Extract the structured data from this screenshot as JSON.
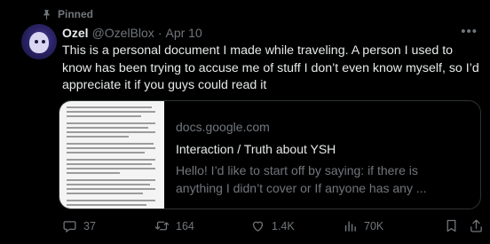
{
  "pinned": {
    "label": "Pinned"
  },
  "author": {
    "display_name": "Ozel",
    "handle": "@OzelBlox",
    "separator": "·",
    "date": "Apr 10"
  },
  "tweet": {
    "text": "This is a personal document I made while traveling. A person I used to know has been trying to accuse me of stuff I don’t even know myself, so I’d appreciate it if you guys could read it"
  },
  "card": {
    "domain": "docs.google.com",
    "title": "Interaction / Truth about YSH",
    "description": "Hello! I’d like to start off by saying: if there is\nanything I didn’t cover or If anyone has any ..."
  },
  "actions": {
    "replies": "37",
    "reposts": "164",
    "likes": "1.4K",
    "views": "70K"
  },
  "icons": {
    "pin": "pin-icon",
    "more": "more-icon",
    "reply": "reply-icon",
    "repost": "repost-icon",
    "like": "like-icon",
    "views": "views-icon"
  },
  "colors": {
    "background": "#000000",
    "text": "#e7e9ea",
    "muted": "#71767b",
    "border": "#2f3336"
  }
}
